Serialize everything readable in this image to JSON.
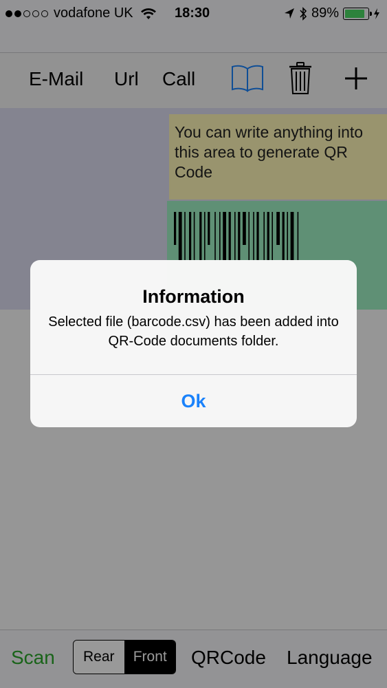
{
  "status_bar": {
    "carrier": "vodafone UK",
    "time": "18:30",
    "battery_percent": "89%",
    "battery_level": 0.89,
    "signal_bars_filled": 2,
    "signal_bars_total": 5
  },
  "toolbar": {
    "email_label": "E-Mail",
    "url_label": "Url",
    "call_label": "Call",
    "icons": [
      "book-icon",
      "trash-icon",
      "plus-icon"
    ]
  },
  "content": {
    "text_area_text": "You can write anything into this area to generate QR Code"
  },
  "bottom_bar": {
    "scan_label": "Scan",
    "camera_options": [
      "Rear",
      "Front"
    ],
    "camera_selected": "Front",
    "qrcode_label": "QRCode",
    "language_label": "Language"
  },
  "alert": {
    "title": "Information",
    "message": "Selected file (barcode.csv) has been added into QR-Code documents folder.",
    "ok_label": "Ok"
  },
  "colors": {
    "accent_blue": "#1a82fb",
    "scan_green": "#2aa52a",
    "text_area_bg": "#fff7b8",
    "barcode_area_bg": "#9ff0c4",
    "content_bg": "#dcdcf0",
    "battery_green": "#4cd964"
  }
}
